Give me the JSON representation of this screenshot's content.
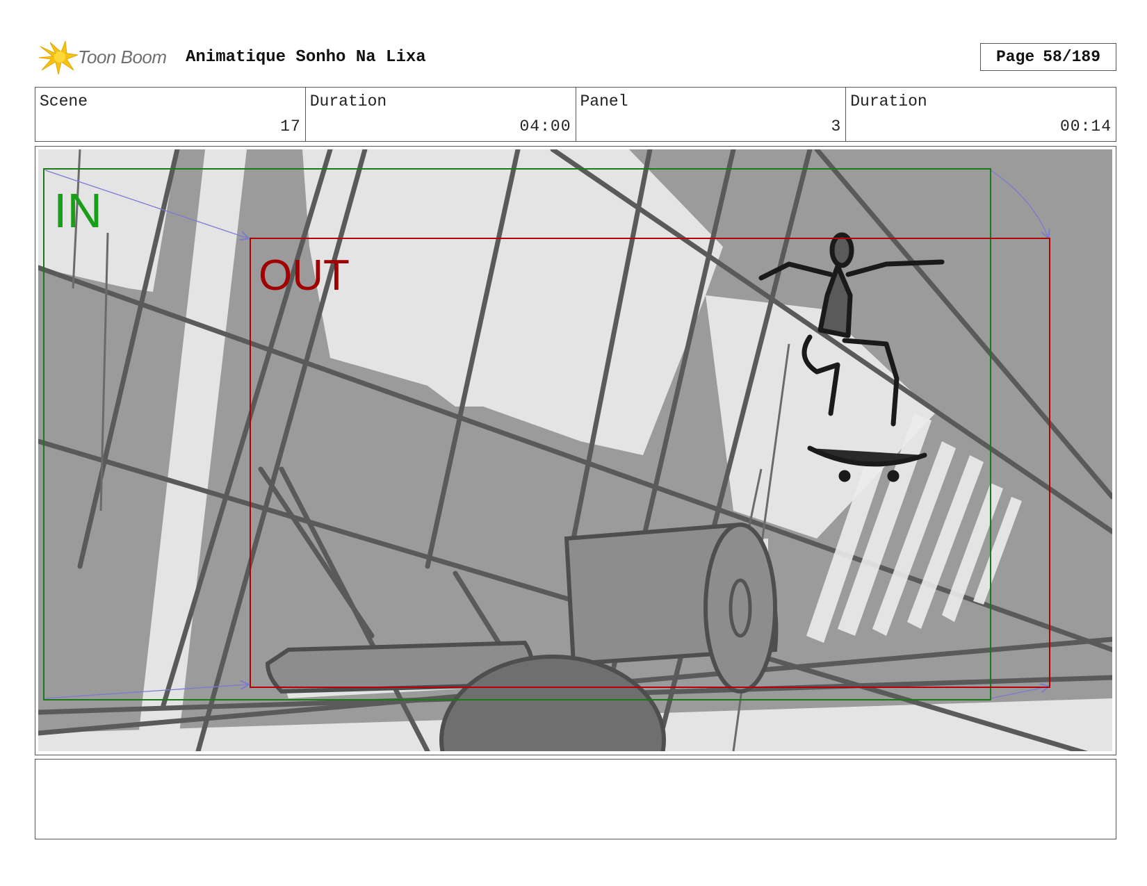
{
  "header": {
    "brand": "Toon Boom",
    "project_title": "Animatique Sonho Na Lixa",
    "page_label": "Page",
    "page_value": "58/189"
  },
  "info": {
    "scene_label": "Scene",
    "scene_value": "17",
    "scene_duration_label": "Duration",
    "scene_duration_value": "04:00",
    "panel_label": "Panel",
    "panel_value": "3",
    "panel_duration_label": "Duration",
    "panel_duration_value": "00:14"
  },
  "panel": {
    "in_label": "IN",
    "out_label": "OUT",
    "in_frame_color": "#1a7a1a",
    "out_frame_color": "#b00000",
    "motion_arrow_color": "#7a7ad0"
  },
  "notes": {
    "text": ""
  }
}
